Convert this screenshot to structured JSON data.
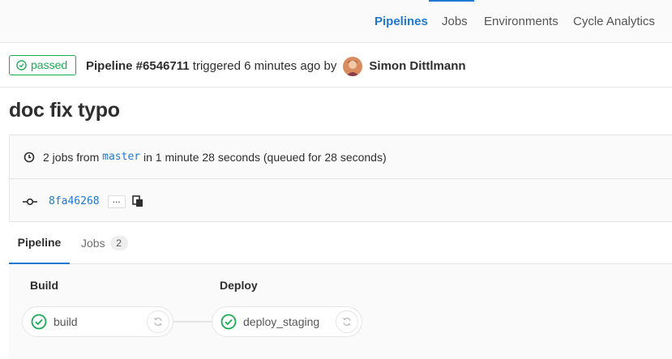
{
  "nav": {
    "tabs": [
      {
        "label": "Pipelines",
        "active": true
      },
      {
        "label": "Jobs",
        "active": false
      },
      {
        "label": "Environments",
        "active": false
      },
      {
        "label": "Cycle Analytics",
        "active": false
      }
    ]
  },
  "header": {
    "status": "passed",
    "pipeline_label": "Pipeline #6546711",
    "triggered_text": " triggered 6 minutes ago by",
    "author": "Simon Dittlmann"
  },
  "title": "doc fix typo",
  "info": {
    "jobs_prefix": "2 jobs from ",
    "branch": "master",
    "duration_text": " in 1 minute 28 seconds (queued for 28 seconds)",
    "commit_sha": "8fa46268",
    "ellipsis": "..."
  },
  "tabs": {
    "pipeline": "Pipeline",
    "jobs": "Jobs",
    "jobs_count": "2"
  },
  "graph": {
    "stages": [
      {
        "title": "Build",
        "jobs": [
          {
            "name": "build",
            "status": "success"
          }
        ]
      },
      {
        "title": "Deploy",
        "jobs": [
          {
            "name": "deploy_staging",
            "status": "success"
          }
        ]
      }
    ]
  },
  "colors": {
    "accent": "#1f78d1",
    "success": "#1aaa55"
  }
}
